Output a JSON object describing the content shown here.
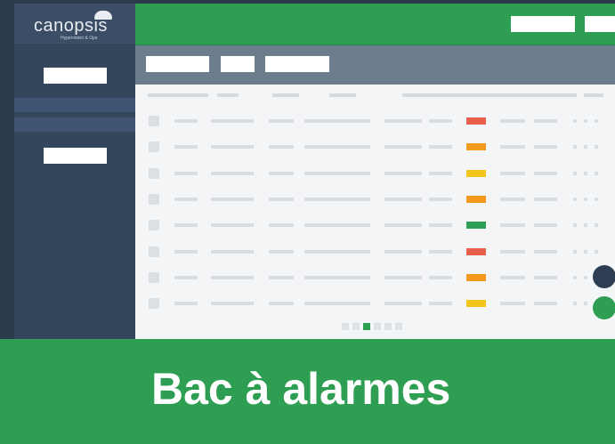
{
  "app": {
    "logo_text": "canopsis",
    "logo_subtitle": "Hypervision & Ops",
    "logo_icon": "cloud-icon"
  },
  "banner": {
    "title": "Bac à alarmes"
  },
  "alarms": {
    "severity_colors": {
      "critical": "#e8604c",
      "major": "#f39a1e",
      "minor": "#f4c51d",
      "ok": "#2e9e52"
    },
    "rows": [
      {
        "severity": "critical"
      },
      {
        "severity": "major"
      },
      {
        "severity": "minor"
      },
      {
        "severity": "major"
      },
      {
        "severity": "ok"
      },
      {
        "severity": "critical"
      },
      {
        "severity": "major"
      },
      {
        "severity": "minor"
      }
    ],
    "pagination": {
      "current_page": 3,
      "pages": 6
    }
  },
  "theme": {
    "accent": "#2e9e52",
    "sidebar": "#34465c",
    "toolbar": "#6e7d8e"
  }
}
